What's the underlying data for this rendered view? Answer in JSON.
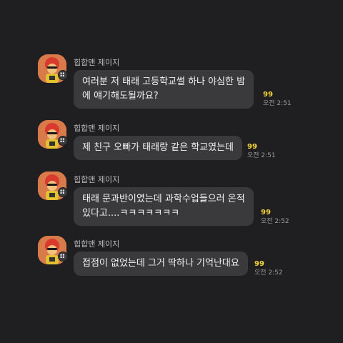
{
  "sender_name": "힙합맨 제이지",
  "messages": [
    {
      "lines": [
        "여러분 저 태래 고등학교썰 하나 야심한 밤",
        "에 얘기해도될까요?"
      ],
      "unread": "99",
      "time": "오전 2:51"
    },
    {
      "lines": [
        "제 친구 오빠가 태래랑 같은 학교였는데"
      ],
      "unread": "99",
      "time": "오전 2:51"
    },
    {
      "lines": [
        "태래 문과반이였는데 과학수업들으러 온적",
        "있다고....ㅋㅋㅋㅋㅋㅋㅋ"
      ],
      "unread": "99",
      "time": "오전 2:52"
    },
    {
      "lines": [
        "접점이 없었는데 그거 딱하나 기억난대요"
      ],
      "unread": "99",
      "time": "오전 2:52"
    }
  ],
  "icons": {
    "avatar": "character-avatar-icon",
    "profile_badge": "profile-card-icon"
  },
  "colors": {
    "background": "#1f1f21",
    "bubble": "#3a3a3c",
    "unread": "#f5d33a",
    "avatar_bg": "#d97a4a"
  }
}
